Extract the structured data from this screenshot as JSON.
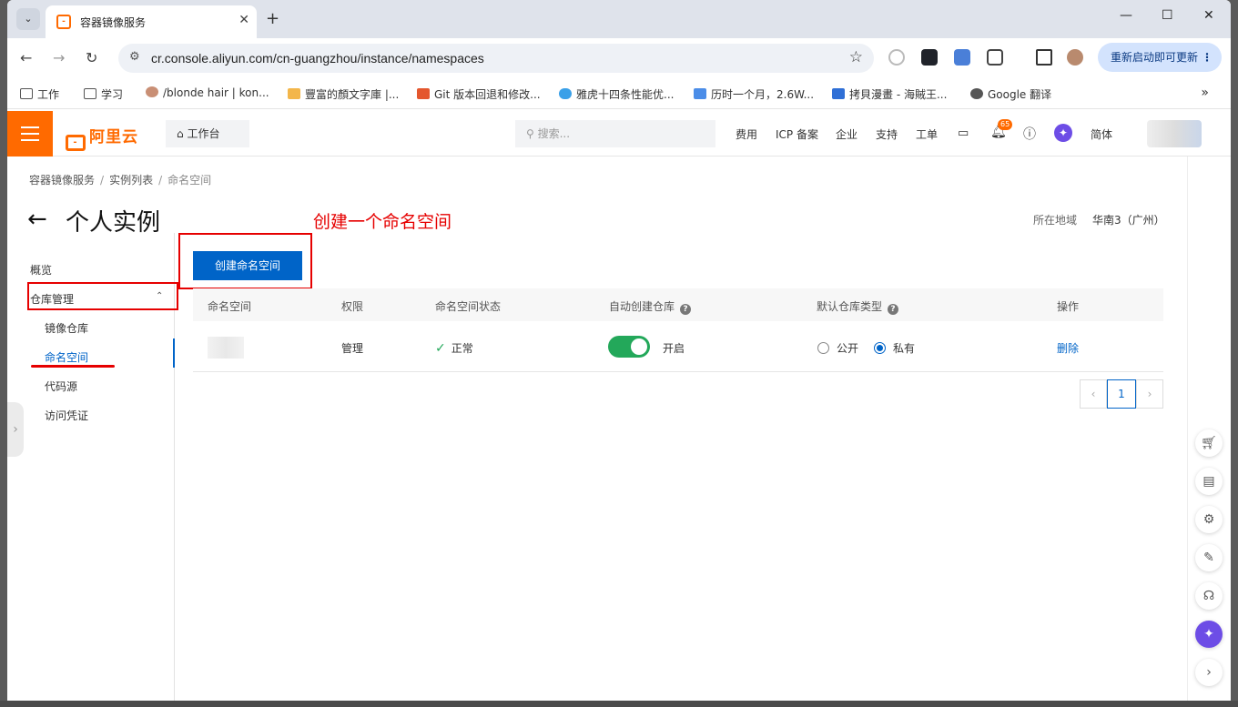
{
  "browser": {
    "tab_title": "容器镜像服务",
    "url": "cr.console.aliyun.com/cn-guangzhou/instance/namespaces",
    "update_button": "重新启动即可更新",
    "bookmarks": [
      {
        "label": "工作"
      },
      {
        "label": "学习"
      },
      {
        "label": "/blonde hair | kon..."
      },
      {
        "label": "豐富的顏文字庫 |..."
      },
      {
        "label": "Git 版本回退和修改..."
      },
      {
        "label": "雅虎十四条性能优..."
      },
      {
        "label": "历时一个月，2.6W..."
      },
      {
        "label": "拷貝漫畫 - 海賊王..."
      },
      {
        "label": "Google 翻译"
      }
    ]
  },
  "header": {
    "logo": "阿里云",
    "workbench": "工作台",
    "search_placeholder": "搜索...",
    "links": [
      "费用",
      "ICP 备案",
      "企业",
      "支持",
      "工单"
    ],
    "notification_count": "65",
    "language": "简体"
  },
  "breadcrumb": [
    "容器镜像服务",
    "实例列表",
    "命名空间"
  ],
  "page": {
    "title": "个人实例",
    "annotation": "创建一个命名空间",
    "region_label": "所在地域",
    "region_value": "华南3（广州）",
    "create_button": "创建命名空间"
  },
  "sidebar": {
    "overview": "概览",
    "repo_mgmt": "仓库管理",
    "items": [
      "镜像仓库",
      "命名空间",
      "代码源",
      "访问凭证"
    ],
    "active": "命名空间"
  },
  "table": {
    "headers": [
      "命名空间",
      "权限",
      "命名空间状态",
      "自动创建仓库",
      "默认仓库类型",
      "操作"
    ],
    "rows": [
      {
        "namespace": "",
        "permission": "管理",
        "status": "正常",
        "auto_create": "开启",
        "auto_create_on": true,
        "type_public": "公开",
        "type_private": "私有",
        "selected_type": "私有",
        "action": "删除"
      }
    ],
    "current_page": "1"
  },
  "colors": {
    "brand": "#ff6a00",
    "primary": "#0064c8",
    "success": "#23a85a",
    "annotation_red": "#e60000"
  }
}
